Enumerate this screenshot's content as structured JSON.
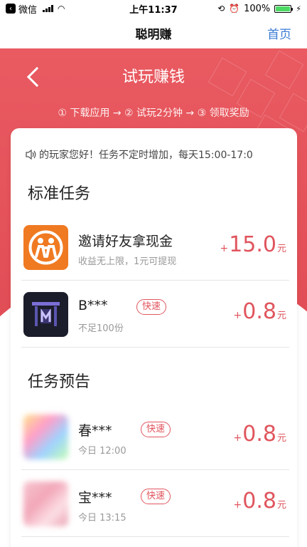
{
  "status_bar": {
    "app_back": "微信",
    "time": "上午11:37",
    "battery": "100%"
  },
  "nav": {
    "title": "聪明赚",
    "home": "首页"
  },
  "hero": {
    "title": "试玩赚钱",
    "steps": "① 下载应用 → ② 试玩2分钟 → ③ 领取奖励"
  },
  "notice": {
    "text": "的玩家您好！任务不定时增加，每天15:00-17:0"
  },
  "sections": {
    "standard_title": "标准任务",
    "preview_title": "任务预告"
  },
  "standard_tasks": [
    {
      "name": "邀请好友拿现金",
      "subtitle": "收益无上限，1元可提现",
      "plus": "+",
      "amount": "15.0",
      "unit": "元",
      "badge": "",
      "icon": "invite-friends-icon"
    },
    {
      "name": "B***",
      "subtitle": "不足100份",
      "plus": "+",
      "amount": "0.8",
      "unit": "元",
      "badge": "快速",
      "icon": "game-app-icon"
    }
  ],
  "preview_tasks": [
    {
      "name": "春***",
      "subtitle": "今日 12:00",
      "plus": "+",
      "amount": "0.8",
      "unit": "元",
      "badge": "快速",
      "icon": "blurred-app-icon"
    },
    {
      "name": "宝***",
      "subtitle": "今日 13:15",
      "plus": "+",
      "amount": "0.8",
      "unit": "元",
      "badge": "快速",
      "icon": "blurred-app-icon"
    }
  ],
  "colors": {
    "accent": "#e0555d",
    "nav_link": "#3a7bd5",
    "hero_bg": "#e95a61"
  }
}
